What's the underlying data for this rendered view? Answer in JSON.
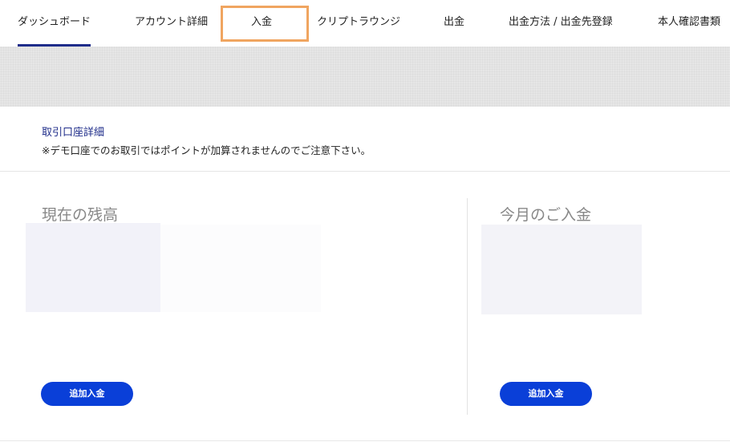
{
  "nav": {
    "tabs": [
      {
        "label": "ダッシュボード"
      },
      {
        "label": "アカウント詳細"
      },
      {
        "label": "入金"
      },
      {
        "label": "クリプトラウンジ"
      },
      {
        "label": "出金"
      },
      {
        "label": "出金方法 / 出金先登録"
      },
      {
        "label": "本人確認書類"
      }
    ]
  },
  "account": {
    "link": "取引口座詳細",
    "notice": "※デモ口座でのお取引ではポイントが加算されませんのでご注意下さい。"
  },
  "balance": {
    "title": "現在の残高",
    "button": "追加入金"
  },
  "monthly": {
    "title": "今月のご入金",
    "button": "追加入金"
  },
  "colors": {
    "accent": "#1f2d8a",
    "button": "#0a3fd8",
    "highlight": "#f0a560"
  }
}
